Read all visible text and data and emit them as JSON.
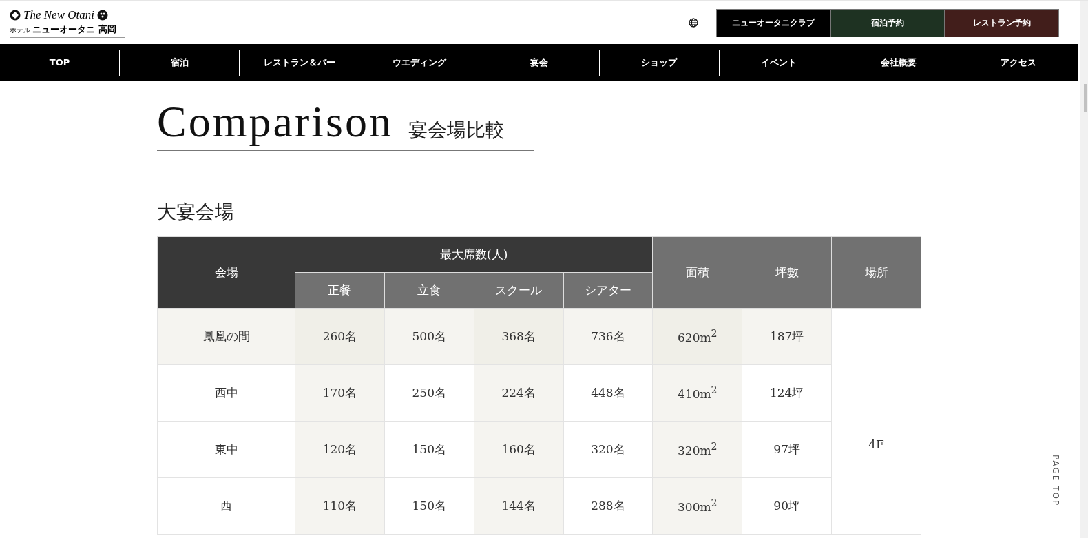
{
  "logo": {
    "script": "The New Otani",
    "prefix": "ホテル",
    "name": "ニューオータニ 高岡"
  },
  "utility_buttons": [
    {
      "label": "ニューオータニクラブ",
      "color": "#000000"
    },
    {
      "label": "宿泊予約",
      "color": "#1e3222"
    },
    {
      "label": "レストラン予約",
      "color": "#421e1b"
    }
  ],
  "nav": [
    "TOP",
    "宿泊",
    "レストラン＆バー",
    "ウエディング",
    "宴会",
    "ショップ",
    "イベント",
    "会社概要",
    "アクセス"
  ],
  "title": {
    "english": "Comparison",
    "japanese": "宴会場比較"
  },
  "section_heading": "大宴会場",
  "table": {
    "venue_header": "会場",
    "seats_header": "最大席数(人)",
    "seat_columns": [
      "正餐",
      "立食",
      "スクール",
      "シアター"
    ],
    "area_header": "面積",
    "tsubo_header": "坪數",
    "place_header": "場所",
    "place": "4F",
    "rows": [
      {
        "name": "鳳凰の間",
        "linked": true,
        "highlighted": true,
        "seats": [
          "260名",
          "500名",
          "368名",
          "736名"
        ],
        "area": "620m$^{2}$",
        "tsubo": "187坪"
      },
      {
        "name": "西中",
        "linked": false,
        "highlighted": false,
        "seats": [
          "170名",
          "250名",
          "224名",
          "448名"
        ],
        "area": "410m$^{2}$",
        "tsubo": "124坪"
      },
      {
        "name": "東中",
        "linked": false,
        "highlighted": false,
        "seats": [
          "120名",
          "150名",
          "160名",
          "320名"
        ],
        "area": "320m$^{2}$",
        "tsubo": "97坪"
      },
      {
        "name": "西",
        "linked": false,
        "highlighted": false,
        "seats": [
          "110名",
          "150名",
          "144名",
          "288名"
        ],
        "area": "300m$^{2}$",
        "tsubo": "90坪"
      }
    ]
  },
  "page_top": "PAGE TOP"
}
